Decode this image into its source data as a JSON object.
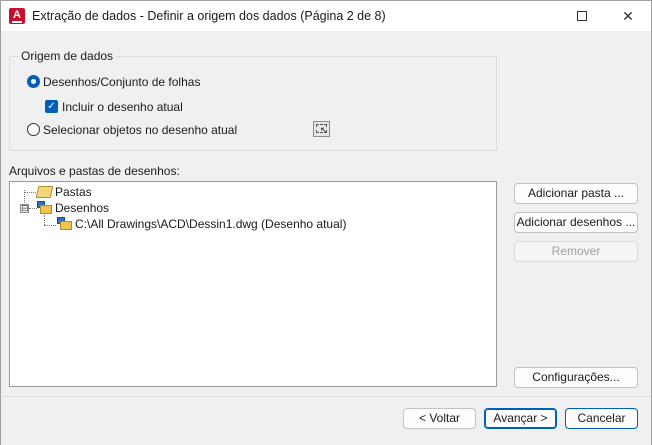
{
  "window": {
    "title": "Extração de dados - Definir a origem dos dados (Página 2 de 8)",
    "app_icon_letter": "A",
    "maximize_icon": "maximize-icon",
    "close_glyph": "✕"
  },
  "data_source": {
    "legend": "Origem de dados",
    "option_drawings": "Desenhos/Conjunto de folhas",
    "option_drawings_selected": true,
    "include_current": "Incluir o desenho atual",
    "include_current_checked": true,
    "option_select_objects": "Selecionar objetos no desenho atual",
    "option_select_objects_selected": false
  },
  "files": {
    "label": "Arquivos e pastas de desenhos:",
    "tree": [
      {
        "label": "Pastas",
        "icon": "folder-open-icon"
      },
      {
        "label": "Desenhos",
        "icon": "drawings-folder-icon",
        "expander": "⊟"
      },
      {
        "label": "C:\\All Drawings\\ACD\\Dessin1.dwg (Desenho atual)",
        "icon": "dwg-file-icon"
      }
    ]
  },
  "side_buttons": {
    "add_folder": "Adicionar pasta ...",
    "add_drawings": "Adicionar desenhos ...",
    "remove": "Remover",
    "settings": "Configurações..."
  },
  "footer": {
    "back": "< Voltar",
    "next": "Avançar >",
    "cancel": "Cancelar"
  },
  "colors": {
    "accent": "#005fb8",
    "app_icon": "#c8102e"
  }
}
